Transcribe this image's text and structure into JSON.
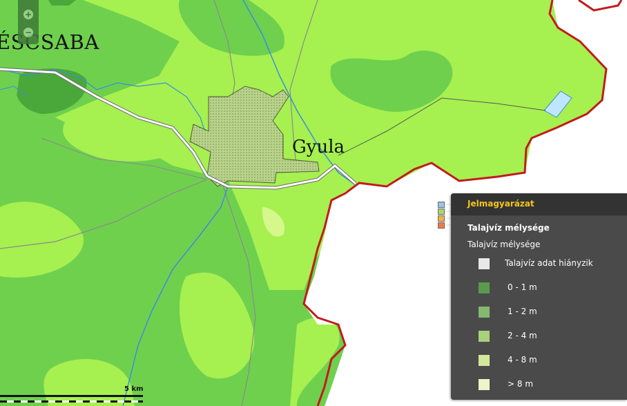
{
  "map": {
    "places": {
      "bekes": "ÉSCSABA",
      "gyula": "Gyula"
    },
    "scale": "5 km",
    "zoom": {
      "in": "+",
      "out": "−"
    }
  },
  "legend": {
    "title": "Jelmagyarázat",
    "layer": "Talajvíz mélysége",
    "subtitle": "Talajvíz mélysége",
    "items": [
      {
        "label": "Talajvíz adat hiányzik",
        "color": "#e8e8e8"
      },
      {
        "label": "0 - 1 m",
        "color": "#5a9a4c"
      },
      {
        "label": "1 - 2 m",
        "color": "#86b86e"
      },
      {
        "label": "2 - 4 m",
        "color": "#a8d17a"
      },
      {
        "label": "4 - 8 m",
        "color": "#d2e89a"
      },
      {
        "label": "> 8 m",
        "color": "#eef5c8"
      }
    ]
  },
  "colors": {
    "zone_0_1": "#4aa83a",
    "zone_1_2": "#6fd04e",
    "zone_2_4": "#a6f050",
    "zone_4_8": "#d6f78c",
    "border": "#c21b1b",
    "river": "#3a8de0",
    "lake": "#bfe6ff"
  },
  "icons": [
    "zoom-in-icon",
    "zoom-out-icon",
    "layers-icon",
    "legend-icon",
    "tool-icon",
    "warning-icon"
  ]
}
